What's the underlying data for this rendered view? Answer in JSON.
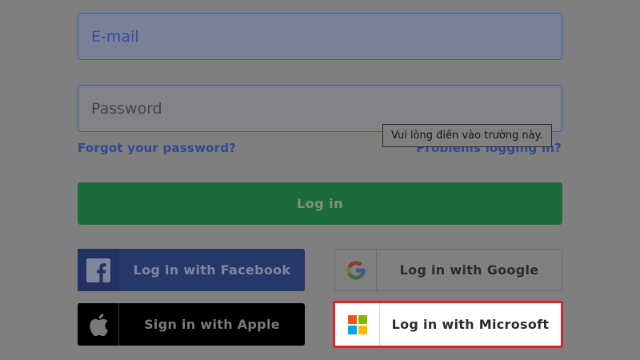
{
  "form": {
    "email_placeholder": "E-mail",
    "password_placeholder": "Password",
    "forgot_label": "Forgot your password?",
    "problems_label": "Problems logging in?",
    "tooltip_text": "Vui lòng điền vào trường này.",
    "login_label": "Log in"
  },
  "social": {
    "facebook_label": "Log in with Facebook",
    "google_label": "Log in with Google",
    "apple_label": "Sign in with Apple",
    "microsoft_label": "Log in with Microsoft"
  },
  "colors": {
    "overlay": "#7f7f7f",
    "highlight": "#d8262a",
    "login_green": "#1d6b3c",
    "facebook_blue": "#26386a"
  },
  "icons": [
    "facebook-icon",
    "google-icon",
    "apple-icon",
    "microsoft-icon"
  ]
}
